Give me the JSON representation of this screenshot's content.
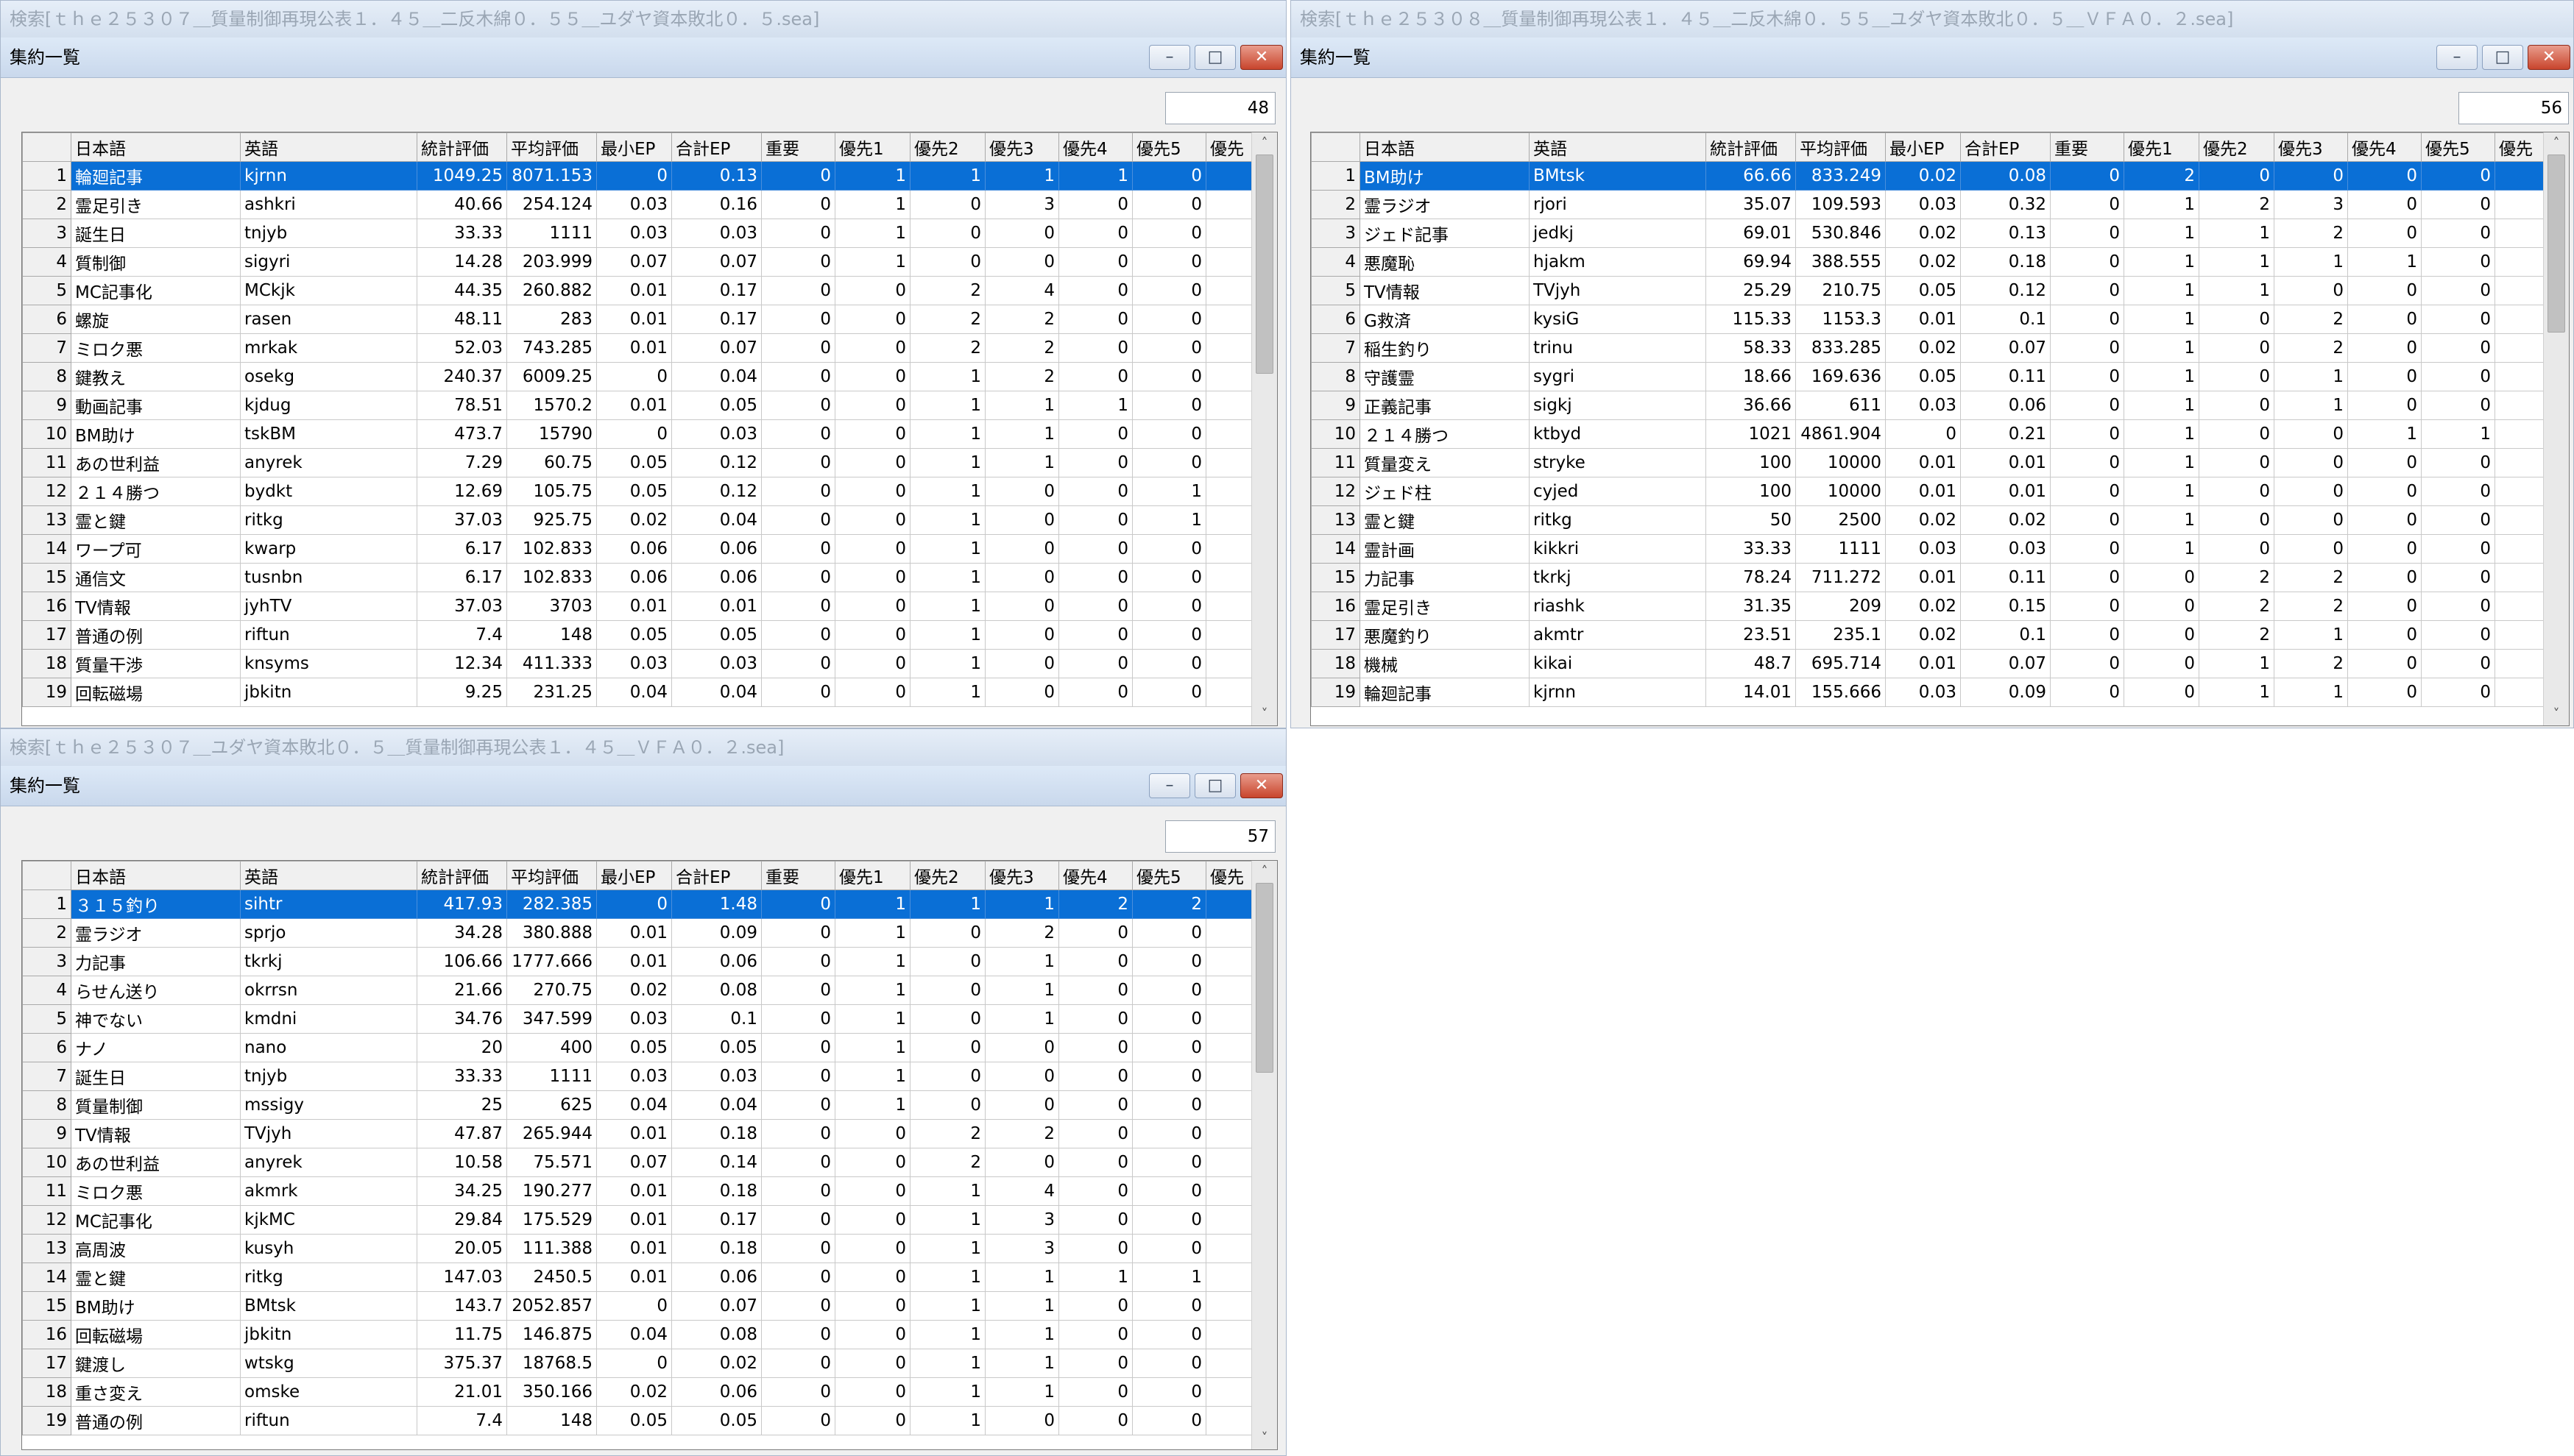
{
  "columns": [
    "",
    "日本語",
    "英語",
    "統計評価",
    "平均評価",
    "最小EP",
    "合計EP",
    "重要",
    "優先1",
    "優先2",
    "優先3",
    "優先4",
    "優先5",
    "優先"
  ],
  "windows": [
    {
      "caption": "検索[ｔｈｅ２５３０７＿質量制御再現公表１．４５＿二反木綿０．５５＿ユダヤ資本敗北０．５.sea]",
      "title": "集約一覧",
      "count": "48",
      "rows": [
        [
          "1",
          "輪廻記事",
          "kjrnn",
          "1049.25",
          "8071.153",
          "0",
          "0.13",
          "0",
          "1",
          "1",
          "1",
          "1",
          "0"
        ],
        [
          "2",
          "霊足引き",
          "ashkri",
          "40.66",
          "254.124",
          "0.03",
          "0.16",
          "0",
          "1",
          "0",
          "3",
          "0",
          "0"
        ],
        [
          "3",
          "誕生日",
          "tnjyb",
          "33.33",
          "1111",
          "0.03",
          "0.03",
          "0",
          "1",
          "0",
          "0",
          "0",
          "0"
        ],
        [
          "4",
          "質制御",
          "sigyri",
          "14.28",
          "203.999",
          "0.07",
          "0.07",
          "0",
          "1",
          "0",
          "0",
          "0",
          "0"
        ],
        [
          "5",
          "MC記事化",
          "MCkjk",
          "44.35",
          "260.882",
          "0.01",
          "0.17",
          "0",
          "0",
          "2",
          "4",
          "0",
          "0"
        ],
        [
          "6",
          "螺旋",
          "rasen",
          "48.11",
          "283",
          "0.01",
          "0.17",
          "0",
          "0",
          "2",
          "2",
          "0",
          "0"
        ],
        [
          "7",
          "ミロク悪",
          "mrkak",
          "52.03",
          "743.285",
          "0.01",
          "0.07",
          "0",
          "0",
          "2",
          "2",
          "0",
          "0"
        ],
        [
          "8",
          "鍵教え",
          "osekg",
          "240.37",
          "6009.25",
          "0",
          "0.04",
          "0",
          "0",
          "1",
          "2",
          "0",
          "0"
        ],
        [
          "9",
          "動画記事",
          "kjdug",
          "78.51",
          "1570.2",
          "0.01",
          "0.05",
          "0",
          "0",
          "1",
          "1",
          "1",
          "0"
        ],
        [
          "10",
          "BM助け",
          "tskBM",
          "473.7",
          "15790",
          "0",
          "0.03",
          "0",
          "0",
          "1",
          "1",
          "0",
          "0"
        ],
        [
          "11",
          "あの世利益",
          "anyrek",
          "7.29",
          "60.75",
          "0.05",
          "0.12",
          "0",
          "0",
          "1",
          "1",
          "0",
          "0"
        ],
        [
          "12",
          "２１４勝つ",
          "bydkt",
          "12.69",
          "105.75",
          "0.05",
          "0.12",
          "0",
          "0",
          "1",
          "0",
          "0",
          "1"
        ],
        [
          "13",
          "霊と鍵",
          "ritkg",
          "37.03",
          "925.75",
          "0.02",
          "0.04",
          "0",
          "0",
          "1",
          "0",
          "0",
          "1"
        ],
        [
          "14",
          "ワープ可",
          "kwarp",
          "6.17",
          "102.833",
          "0.06",
          "0.06",
          "0",
          "0",
          "1",
          "0",
          "0",
          "0"
        ],
        [
          "15",
          "通信文",
          "tusnbn",
          "6.17",
          "102.833",
          "0.06",
          "0.06",
          "0",
          "0",
          "1",
          "0",
          "0",
          "0"
        ],
        [
          "16",
          "TV情報",
          "jyhTV",
          "37.03",
          "3703",
          "0.01",
          "0.01",
          "0",
          "0",
          "1",
          "0",
          "0",
          "0"
        ],
        [
          "17",
          "普通の例",
          "riftun",
          "7.4",
          "148",
          "0.05",
          "0.05",
          "0",
          "0",
          "1",
          "0",
          "0",
          "0"
        ],
        [
          "18",
          "質量干渉",
          "knsyms",
          "12.34",
          "411.333",
          "0.03",
          "0.03",
          "0",
          "0",
          "1",
          "0",
          "0",
          "0"
        ],
        [
          "19",
          "回転磁場",
          "jbkitn",
          "9.25",
          "231.25",
          "0.04",
          "0.04",
          "0",
          "0",
          "1",
          "0",
          "0",
          "0"
        ]
      ]
    },
    {
      "caption": "検索[ｔｈｅ２５３０８＿質量制御再現公表１．４５＿二反木綿０．５５＿ユダヤ資本敗北０．５＿ＶＦＡ０．２.sea]",
      "title": "集約一覧",
      "count": "56",
      "rows": [
        [
          "1",
          "BM助け",
          "BMtsk",
          "66.66",
          "833.249",
          "0.02",
          "0.08",
          "0",
          "2",
          "0",
          "0",
          "0",
          "0"
        ],
        [
          "2",
          "霊ラジオ",
          "rjori",
          "35.07",
          "109.593",
          "0.03",
          "0.32",
          "0",
          "1",
          "2",
          "3",
          "0",
          "0"
        ],
        [
          "3",
          "ジェド記事",
          "jedkj",
          "69.01",
          "530.846",
          "0.02",
          "0.13",
          "0",
          "1",
          "1",
          "2",
          "0",
          "0"
        ],
        [
          "4",
          "悪魔恥",
          "hjakm",
          "69.94",
          "388.555",
          "0.02",
          "0.18",
          "0",
          "1",
          "1",
          "1",
          "1",
          "0"
        ],
        [
          "5",
          "TV情報",
          "TVjyh",
          "25.29",
          "210.75",
          "0.05",
          "0.12",
          "0",
          "1",
          "1",
          "0",
          "0",
          "0"
        ],
        [
          "6",
          "G救済",
          "kysiG",
          "115.33",
          "1153.3",
          "0.01",
          "0.1",
          "0",
          "1",
          "0",
          "2",
          "0",
          "0"
        ],
        [
          "7",
          "稲生釣り",
          "trinu",
          "58.33",
          "833.285",
          "0.02",
          "0.07",
          "0",
          "1",
          "0",
          "2",
          "0",
          "0"
        ],
        [
          "8",
          "守護霊",
          "sygri",
          "18.66",
          "169.636",
          "0.05",
          "0.11",
          "0",
          "1",
          "0",
          "1",
          "0",
          "0"
        ],
        [
          "9",
          "正義記事",
          "sigkj",
          "36.66",
          "611",
          "0.03",
          "0.06",
          "0",
          "1",
          "0",
          "1",
          "0",
          "0"
        ],
        [
          "10",
          "２１４勝つ",
          "ktbyd",
          "1021",
          "4861.904",
          "0",
          "0.21",
          "0",
          "1",
          "0",
          "0",
          "1",
          "1"
        ],
        [
          "11",
          "質量変え",
          "stryke",
          "100",
          "10000",
          "0.01",
          "0.01",
          "0",
          "1",
          "0",
          "0",
          "0",
          "0"
        ],
        [
          "12",
          "ジェド柱",
          "cyjed",
          "100",
          "10000",
          "0.01",
          "0.01",
          "0",
          "1",
          "0",
          "0",
          "0",
          "0"
        ],
        [
          "13",
          "霊と鍵",
          "ritkg",
          "50",
          "2500",
          "0.02",
          "0.02",
          "0",
          "1",
          "0",
          "0",
          "0",
          "0"
        ],
        [
          "14",
          "霊計画",
          "kikkri",
          "33.33",
          "1111",
          "0.03",
          "0.03",
          "0",
          "1",
          "0",
          "0",
          "0",
          "0"
        ],
        [
          "15",
          "力記事",
          "tkrkj",
          "78.24",
          "711.272",
          "0.01",
          "0.11",
          "0",
          "0",
          "2",
          "2",
          "0",
          "0"
        ],
        [
          "16",
          "霊足引き",
          "riashk",
          "31.35",
          "209",
          "0.02",
          "0.15",
          "0",
          "0",
          "2",
          "2",
          "0",
          "0"
        ],
        [
          "17",
          "悪魔釣り",
          "akmtr",
          "23.51",
          "235.1",
          "0.02",
          "0.1",
          "0",
          "0",
          "2",
          "1",
          "0",
          "0"
        ],
        [
          "18",
          "機械",
          "kikai",
          "48.7",
          "695.714",
          "0.01",
          "0.07",
          "0",
          "0",
          "1",
          "2",
          "0",
          "0"
        ],
        [
          "19",
          "輪廻記事",
          "kjrnn",
          "14.01",
          "155.666",
          "0.03",
          "0.09",
          "0",
          "0",
          "1",
          "1",
          "0",
          "0"
        ]
      ]
    },
    {
      "caption": "検索[ｔｈｅ２５３０７＿ユダヤ資本敗北０．５＿質量制御再現公表１．４５＿ＶＦＡ０．２.sea]",
      "title": "集約一覧",
      "count": "57",
      "rows": [
        [
          "1",
          "３１５釣り",
          "sihtr",
          "417.93",
          "282.385",
          "0",
          "1.48",
          "0",
          "1",
          "1",
          "1",
          "2",
          "2"
        ],
        [
          "2",
          "霊ラジオ",
          "sprjo",
          "34.28",
          "380.888",
          "0.01",
          "0.09",
          "0",
          "1",
          "0",
          "2",
          "0",
          "0"
        ],
        [
          "3",
          "力記事",
          "tkrkj",
          "106.66",
          "1777.666",
          "0.01",
          "0.06",
          "0",
          "1",
          "0",
          "1",
          "0",
          "0"
        ],
        [
          "4",
          "らせん送り",
          "okrrsn",
          "21.66",
          "270.75",
          "0.02",
          "0.08",
          "0",
          "1",
          "0",
          "1",
          "0",
          "0"
        ],
        [
          "5",
          "神でない",
          "kmdni",
          "34.76",
          "347.599",
          "0.03",
          "0.1",
          "0",
          "1",
          "0",
          "1",
          "0",
          "0"
        ],
        [
          "6",
          "ナノ",
          "nano",
          "20",
          "400",
          "0.05",
          "0.05",
          "0",
          "1",
          "0",
          "0",
          "0",
          "0"
        ],
        [
          "7",
          "誕生日",
          "tnjyb",
          "33.33",
          "1111",
          "0.03",
          "0.03",
          "0",
          "1",
          "0",
          "0",
          "0",
          "0"
        ],
        [
          "8",
          "質量制御",
          "mssigy",
          "25",
          "625",
          "0.04",
          "0.04",
          "0",
          "1",
          "0",
          "0",
          "0",
          "0"
        ],
        [
          "9",
          "TV情報",
          "TVjyh",
          "47.87",
          "265.944",
          "0.01",
          "0.18",
          "0",
          "0",
          "2",
          "2",
          "0",
          "0"
        ],
        [
          "10",
          "あの世利益",
          "anyrek",
          "10.58",
          "75.571",
          "0.07",
          "0.14",
          "0",
          "0",
          "2",
          "0",
          "0",
          "0"
        ],
        [
          "11",
          "ミロク悪",
          "akmrk",
          "34.25",
          "190.277",
          "0.01",
          "0.18",
          "0",
          "0",
          "1",
          "4",
          "0",
          "0"
        ],
        [
          "12",
          "MC記事化",
          "kjkMC",
          "29.84",
          "175.529",
          "0.01",
          "0.17",
          "0",
          "0",
          "1",
          "3",
          "0",
          "0"
        ],
        [
          "13",
          "高周波",
          "kusyh",
          "20.05",
          "111.388",
          "0.01",
          "0.18",
          "0",
          "0",
          "1",
          "3",
          "0",
          "0"
        ],
        [
          "14",
          "霊と鍵",
          "ritkg",
          "147.03",
          "2450.5",
          "0.01",
          "0.06",
          "0",
          "0",
          "1",
          "1",
          "1",
          "1"
        ],
        [
          "15",
          "BM助け",
          "BMtsk",
          "143.7",
          "2052.857",
          "0",
          "0.07",
          "0",
          "0",
          "1",
          "1",
          "0",
          "0"
        ],
        [
          "16",
          "回転磁場",
          "jbkitn",
          "11.75",
          "146.875",
          "0.04",
          "0.08",
          "0",
          "0",
          "1",
          "1",
          "0",
          "0"
        ],
        [
          "17",
          "鍵渡し",
          "wtskg",
          "375.37",
          "18768.5",
          "0",
          "0.02",
          "0",
          "0",
          "1",
          "1",
          "0",
          "0"
        ],
        [
          "18",
          "重さ変え",
          "omske",
          "21.01",
          "350.166",
          "0.02",
          "0.06",
          "0",
          "0",
          "1",
          "1",
          "0",
          "0"
        ],
        [
          "19",
          "普通の例",
          "riftun",
          "7.4",
          "148",
          "0.05",
          "0.05",
          "0",
          "0",
          "1",
          "0",
          "0",
          "0"
        ]
      ]
    }
  ]
}
